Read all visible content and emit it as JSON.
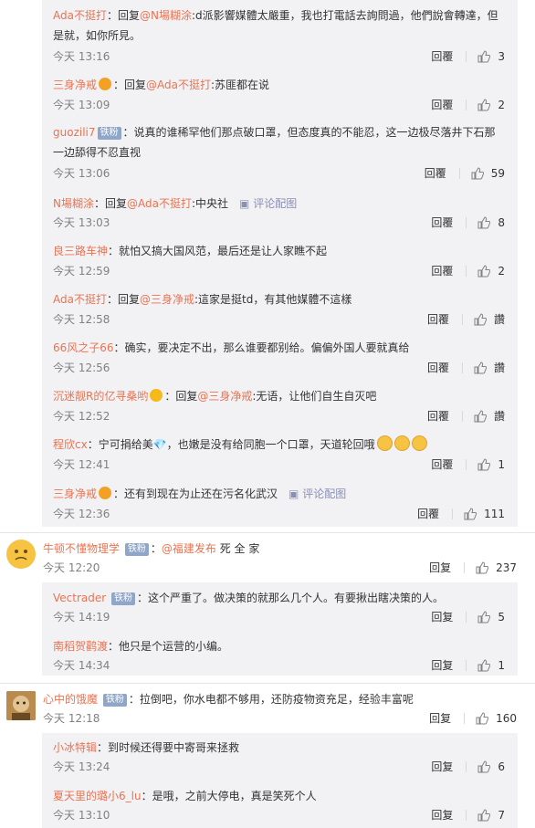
{
  "labels": {
    "reply": "回覆",
    "reply_s": "回复"
  },
  "replies_a": [
    {
      "name": "Ada不挺打",
      "text_prefix": "：回复",
      "mention": "@N場糊涂",
      "text": ":d派影響媒體太嚴重，我也打電話去詢問過，他們說會轉達，但是就，如你所見。",
      "time": "今天 13:16",
      "likes": "3"
    },
    {
      "name": "三身净戒",
      "text_prefix": "：回复",
      "mention": "@Ada不挺打",
      "text": ":苏匪都在说",
      "time": "今天 13:09",
      "likes": "2"
    },
    {
      "name": "guozili7",
      "badge": "铁粉",
      "text": "：说真的谁稀罕他们那点破口罩，但态度真的不能忍，这一边极尽落井下石那一边舔得不忍直视",
      "time": "今天 13:06",
      "likes": "59"
    },
    {
      "name": "N場糊涂",
      "text_prefix": "：回复",
      "mention": "@Ada不挺打",
      "text": ":中央社",
      "pic": "评论配图",
      "time": "今天 13:03",
      "likes": "8"
    },
    {
      "name": "良三路车神",
      "text": "：就怕又搞大国风范，最后还是让人家瞧不起",
      "time": "今天 12:59",
      "likes": "2"
    },
    {
      "name": "Ada不挺打",
      "text_prefix": "：回复",
      "mention": "@三身净戒",
      "text": ":這家是挺td，有其他媒體不這樣",
      "time": "今天 12:58",
      "likes": "讚"
    },
    {
      "name": "66风之子66",
      "text": "：确实，要决定不出，那么谁要都别给。偏偏外国人要就真给",
      "time": "今天 12:56",
      "likes": "讚"
    },
    {
      "name": "沉迷靓R的亿寻桑哟",
      "text_prefix": "：回复",
      "mention": "@三身净戒",
      "text": ":无语，让他们自生自灭吧",
      "time": "今天 12:52",
      "likes": "讚"
    },
    {
      "name": "程欣cx",
      "text": "：宁可捐给美💎，也嫩是没有给同胞一个口罩，天道轮回哦",
      "time": "今天 12:41",
      "likes": "1"
    },
    {
      "name": "三身净戒",
      "text": "：还有到现在为止还在污名化武汉",
      "pic": "评论配图",
      "time": "今天 12:36",
      "likes": "111"
    }
  ],
  "comment1": {
    "name": "牛顿不懂物理学",
    "badge": "铁粉",
    "text_prefix": "：",
    "mention": "@福建发布",
    "text": " 死 全 家",
    "time": "今天 12:20",
    "likes": "237"
  },
  "replies_b": [
    {
      "name": "Vectrader",
      "badge": "铁粉",
      "text": "：这个严重了。做决策的就那么几个人。有要揪出瞎决策的人。",
      "time": "今天 14:19",
      "likes": "5"
    },
    {
      "name": "南稻贺鹳渡",
      "text": "：他只是个运营的小编。",
      "time": "今天 14:34",
      "likes": "1"
    }
  ],
  "comment2": {
    "name": "心中的饿魔",
    "badge": "铁粉",
    "text": "：拉倒吧，你水电都不够用，还防疫物资充足，经验丰富呢",
    "time": "今天 12:18",
    "likes": "160"
  },
  "replies_c": [
    {
      "name": "小冰特辑",
      "text": "：到时候还得要中寄哥来拯救",
      "time": "今天 13:24",
      "likes": "6"
    },
    {
      "name": "夏天里的璐小6_lu",
      "text": "：是哦，之前大停电，真是笑死个人",
      "time": "今天 13:10",
      "likes": "7"
    }
  ]
}
